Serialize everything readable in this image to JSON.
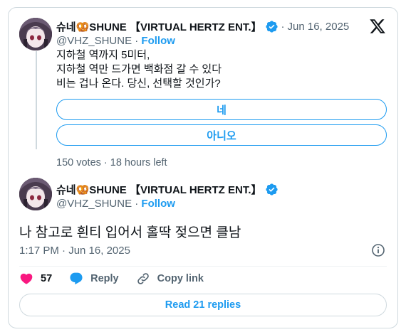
{
  "quoted": {
    "display_name": "슈네🥨SHUNE 【VIRTUAL HERTZ ENT.】",
    "date_sep": "·",
    "date": "Jun 16, 2025",
    "handle": "@VHZ_SHUNE",
    "handle_sep": "·",
    "follow": "Follow",
    "text": "지하철 역까지 5미터,\n지하철 역만 드가면 백화점 갈 수 있다\n비는 겁나 온다. 당신, 선택할 것인가?",
    "poll_options": [
      "네",
      "아니오"
    ],
    "poll_meta": "150 votes · 18 hours left"
  },
  "reply": {
    "display_name": "슈네🥨SHUNE 【VIRTUAL HERTZ ENT.】",
    "handle": "@VHZ_SHUNE",
    "handle_sep": "·",
    "follow": "Follow",
    "text": "나 참고로 흰티 입어서 홀딱 젖으면 클남",
    "timestamp": "1:17 PM · Jun 16, 2025",
    "likes": "57",
    "reply_label": "Reply",
    "copy_link_label": "Copy link",
    "read_replies": "Read 21 replies"
  },
  "colors": {
    "accent": "#1d9bf0",
    "like": "#f91880",
    "muted": "#536471",
    "border": "#cfd9de"
  },
  "icons": [
    "x-logo-icon",
    "verified-badge-icon",
    "heart-icon",
    "reply-bubble-icon",
    "link-icon",
    "info-icon"
  ]
}
